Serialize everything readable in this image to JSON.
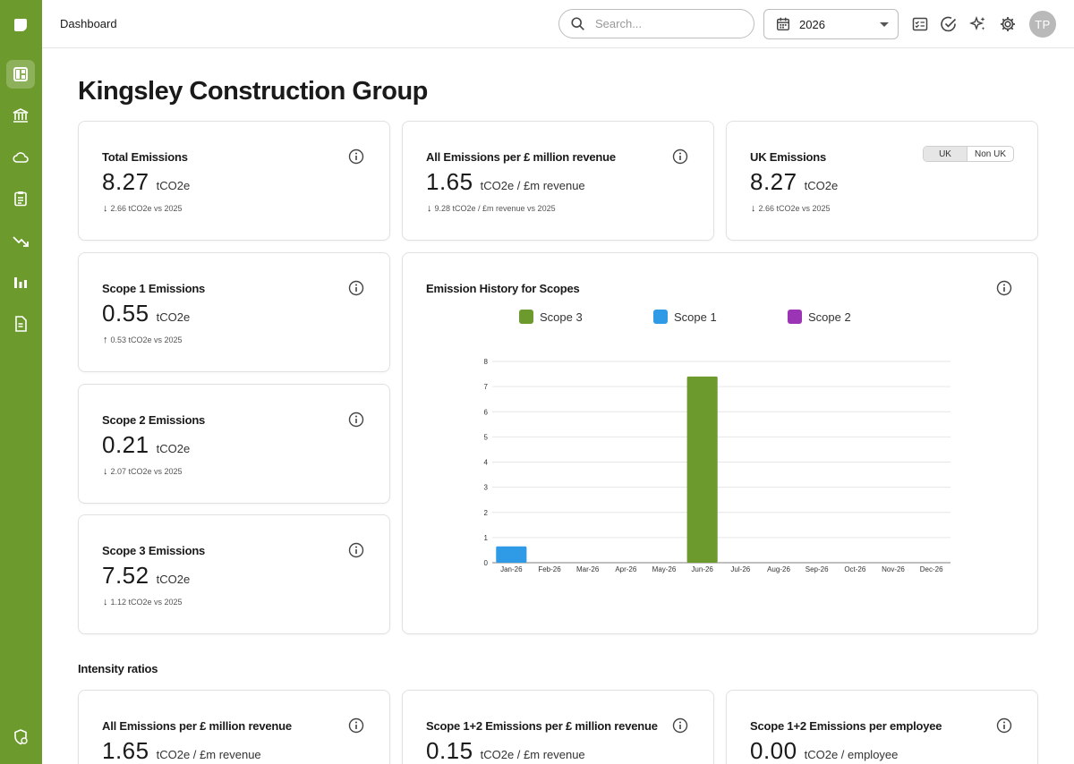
{
  "topbar": {
    "breadcrumb": "Dashboard",
    "search_placeholder": "Search...",
    "year": "2026",
    "avatar_initials": "TP"
  },
  "page_title": "Kingsley Construction Group",
  "cards": {
    "total": {
      "title": "Total Emissions",
      "value": "8.27",
      "unit": "tCO2e",
      "delta": "2.66 tCO2e vs 2025",
      "direction": "down"
    },
    "per_revenue": {
      "title": "All Emissions per £ million revenue",
      "value": "1.65",
      "unit": "tCO2e / £m revenue",
      "delta": "9.28 tCO2e / £m revenue vs 2025",
      "direction": "down"
    },
    "uk": {
      "title": "UK Emissions",
      "value": "8.27",
      "unit": "tCO2e",
      "delta": "2.66 tCO2e vs 2025",
      "direction": "down",
      "toggle_on": "UK",
      "toggle_off": "Non UK"
    },
    "scope1": {
      "title": "Scope 1 Emissions",
      "value": "0.55",
      "unit": "tCO2e",
      "delta": "0.53 tCO2e vs 2025",
      "direction": "up"
    },
    "scope2": {
      "title": "Scope 2 Emissions",
      "value": "0.21",
      "unit": "tCO2e",
      "delta": "2.07 tCO2e vs 2025",
      "direction": "down"
    },
    "scope3": {
      "title": "Scope 3 Emissions",
      "value": "7.52",
      "unit": "tCO2e",
      "delta": "1.12 tCO2e vs 2025",
      "direction": "down"
    }
  },
  "intensity": {
    "label": "Intensity ratios",
    "cards": [
      {
        "title": "All Emissions per £ million revenue",
        "value": "1.65",
        "unit": "tCO2e / £m revenue"
      },
      {
        "title": "Scope 1+2 Emissions per £ million revenue",
        "value": "0.15",
        "unit": "tCO2e / £m revenue"
      },
      {
        "title": "Scope 1+2 Emissions per employee",
        "value": "0.00",
        "unit": "tCO2e / employee"
      }
    ]
  },
  "chart_title": "Emission History for Scopes",
  "chart_data": {
    "type": "bar",
    "stacked": true,
    "title": "Emission History for Scopes",
    "categories": [
      "Jan-26",
      "Feb-26",
      "Mar-26",
      "Apr-26",
      "May-26",
      "Jun-26",
      "Jul-26",
      "Aug-26",
      "Sep-26",
      "Oct-26",
      "Nov-26",
      "Dec-26"
    ],
    "series": [
      {
        "name": "Scope 3",
        "color": "#6d9a2c",
        "values": [
          0,
          0,
          0,
          0,
          0,
          7.4,
          0,
          0,
          0,
          0,
          0,
          0
        ]
      },
      {
        "name": "Scope 1",
        "color": "#2f9be6",
        "values": [
          0.65,
          0,
          0,
          0,
          0,
          0,
          0,
          0,
          0,
          0,
          0,
          0
        ]
      },
      {
        "name": "Scope 2",
        "color": "#9b35b5",
        "values": [
          0,
          0,
          0,
          0,
          0,
          0,
          0,
          0,
          0,
          0,
          0,
          0
        ]
      }
    ],
    "ylim": [
      0,
      8
    ],
    "yticks": [
      0,
      1,
      2,
      3,
      4,
      5,
      6,
      7,
      8
    ],
    "grid": true,
    "legend": "top-center"
  },
  "colors": {
    "brand": "#6d9a2c",
    "scope1": "#2f9be6",
    "scope2": "#9b35b5",
    "scope3": "#6d9a2c"
  },
  "sidebar_icons": [
    "logo-icon",
    "dashboard-icon",
    "bank-icon",
    "cloud-icon",
    "clipboard-icon",
    "trending-down-icon",
    "bar-chart-icon",
    "document-icon",
    "settings-shield-icon"
  ]
}
